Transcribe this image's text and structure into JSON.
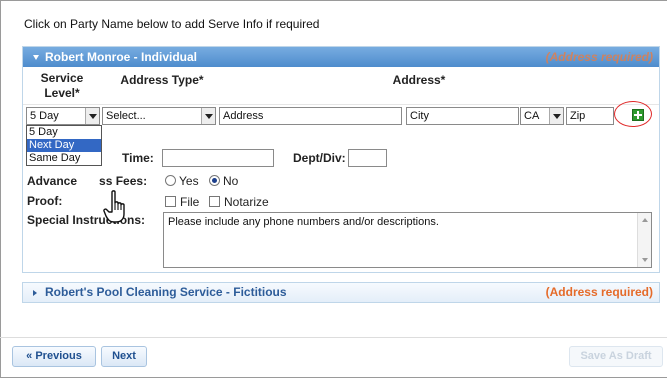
{
  "instruction": "Click on Party Name below to add Serve Info if required",
  "party1": {
    "name": "Robert Monroe - Individual",
    "address_required": "(Address required)",
    "columns": {
      "service_level": "Service Level*",
      "address_type": "Address Type*",
      "address": "Address*"
    },
    "service_level_value": "5 Day",
    "service_level_options": [
      "5 Day",
      "Next Day",
      "Same Day"
    ],
    "service_level_highlighted": "Next Day",
    "address_type_value": "Select...",
    "address_value": "Address",
    "city_value": "City",
    "state_value": "CA",
    "zip_value": "Zip",
    "time_label": "Time:",
    "dept_label": "Dept/Div:",
    "advance_fees_label": "Advance",
    "advance_fees_label_tail": "ss Fees:",
    "advance_fees_options": [
      "Yes",
      "No"
    ],
    "advance_fees_selected": "No",
    "proof_label": "Proof:",
    "proof_options": [
      "File",
      "Notarize"
    ],
    "special_instructions_label": "Special Instructions:",
    "special_instructions_text": "Please include any phone numbers and/or descriptions."
  },
  "party2": {
    "name": "Robert's Pool Cleaning Service - Fictitious",
    "address_required": "(Address required)"
  },
  "buttons": {
    "previous": "« Previous",
    "next": "Next",
    "save_draft": "Save As Draft"
  },
  "icons": {
    "add": "add-green-plus-icon",
    "cursor": "hand-pointer-icon"
  },
  "colors": {
    "header_blue": "#5f9bd8",
    "address_required_orange": "#e56b2a",
    "add_green": "#2e9a2e",
    "highlight_circle": "#e02828"
  }
}
